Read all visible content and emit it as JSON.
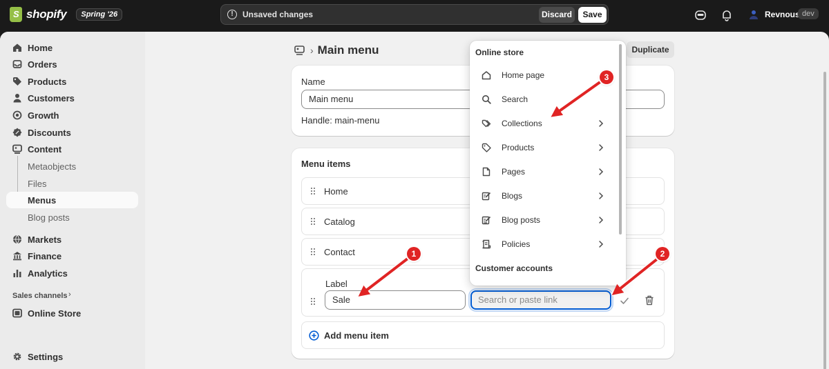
{
  "topbar": {
    "brand": "shopify",
    "edition_badge": "Spring '26",
    "unsaved_text": "Unsaved changes",
    "discard_label": "Discard",
    "save_label": "Save",
    "user_name": "Revnous",
    "user_badge": "dev"
  },
  "sidebar": {
    "items": [
      {
        "label": "Home",
        "icon": "home-icon"
      },
      {
        "label": "Orders",
        "icon": "inbox-icon"
      },
      {
        "label": "Products",
        "icon": "tag-icon"
      },
      {
        "label": "Customers",
        "icon": "person-icon"
      },
      {
        "label": "Growth",
        "icon": "growth-icon"
      },
      {
        "label": "Discounts",
        "icon": "discount-icon"
      },
      {
        "label": "Content",
        "icon": "content-icon"
      },
      {
        "label": "Metaobjects"
      },
      {
        "label": "Files"
      },
      {
        "label": "Menus"
      },
      {
        "label": "Blog posts"
      },
      {
        "label": "Markets",
        "icon": "globe-icon"
      },
      {
        "label": "Finance",
        "icon": "bank-icon"
      },
      {
        "label": "Analytics",
        "icon": "bar-chart-icon"
      },
      {
        "label": "Online Store",
        "icon": "store-icon"
      },
      {
        "label": "Settings",
        "icon": "gear-icon"
      }
    ],
    "active_item": "Menus",
    "section_title": "Sales channels",
    "section_chevron": "›"
  },
  "page": {
    "separator": "›",
    "title": "Main menu",
    "duplicate_label": "Duplicate"
  },
  "name_card": {
    "name_label": "Name",
    "name_value": "Main menu",
    "handle_text": "Handle: main-menu"
  },
  "menu_card": {
    "title": "Menu items",
    "items": [
      "Home",
      "Catalog",
      "Contact"
    ],
    "edit_label_heading": "Label",
    "edit_label_value": "Sale",
    "link_placeholder": "Search or paste link",
    "add_label": "Add menu item"
  },
  "dropdown": {
    "section1_title": "Online store",
    "items": [
      {
        "label": "Home page",
        "icon": "home-icon",
        "chevron": false
      },
      {
        "label": "Search",
        "icon": "search-icon",
        "chevron": false
      },
      {
        "label": "Collections",
        "icon": "collections-icon",
        "chevron": true
      },
      {
        "label": "Products",
        "icon": "tag-icon",
        "chevron": true
      },
      {
        "label": "Pages",
        "icon": "page-icon",
        "chevron": true
      },
      {
        "label": "Blogs",
        "icon": "blog-icon",
        "chevron": true
      },
      {
        "label": "Blog posts",
        "icon": "blog-post-icon",
        "chevron": true
      },
      {
        "label": "Policies",
        "icon": "policy-icon",
        "chevron": true
      }
    ],
    "section2_title": "Customer accounts"
  },
  "annotations": {
    "color": "#e02424",
    "markers": [
      "1",
      "2",
      "3"
    ]
  }
}
